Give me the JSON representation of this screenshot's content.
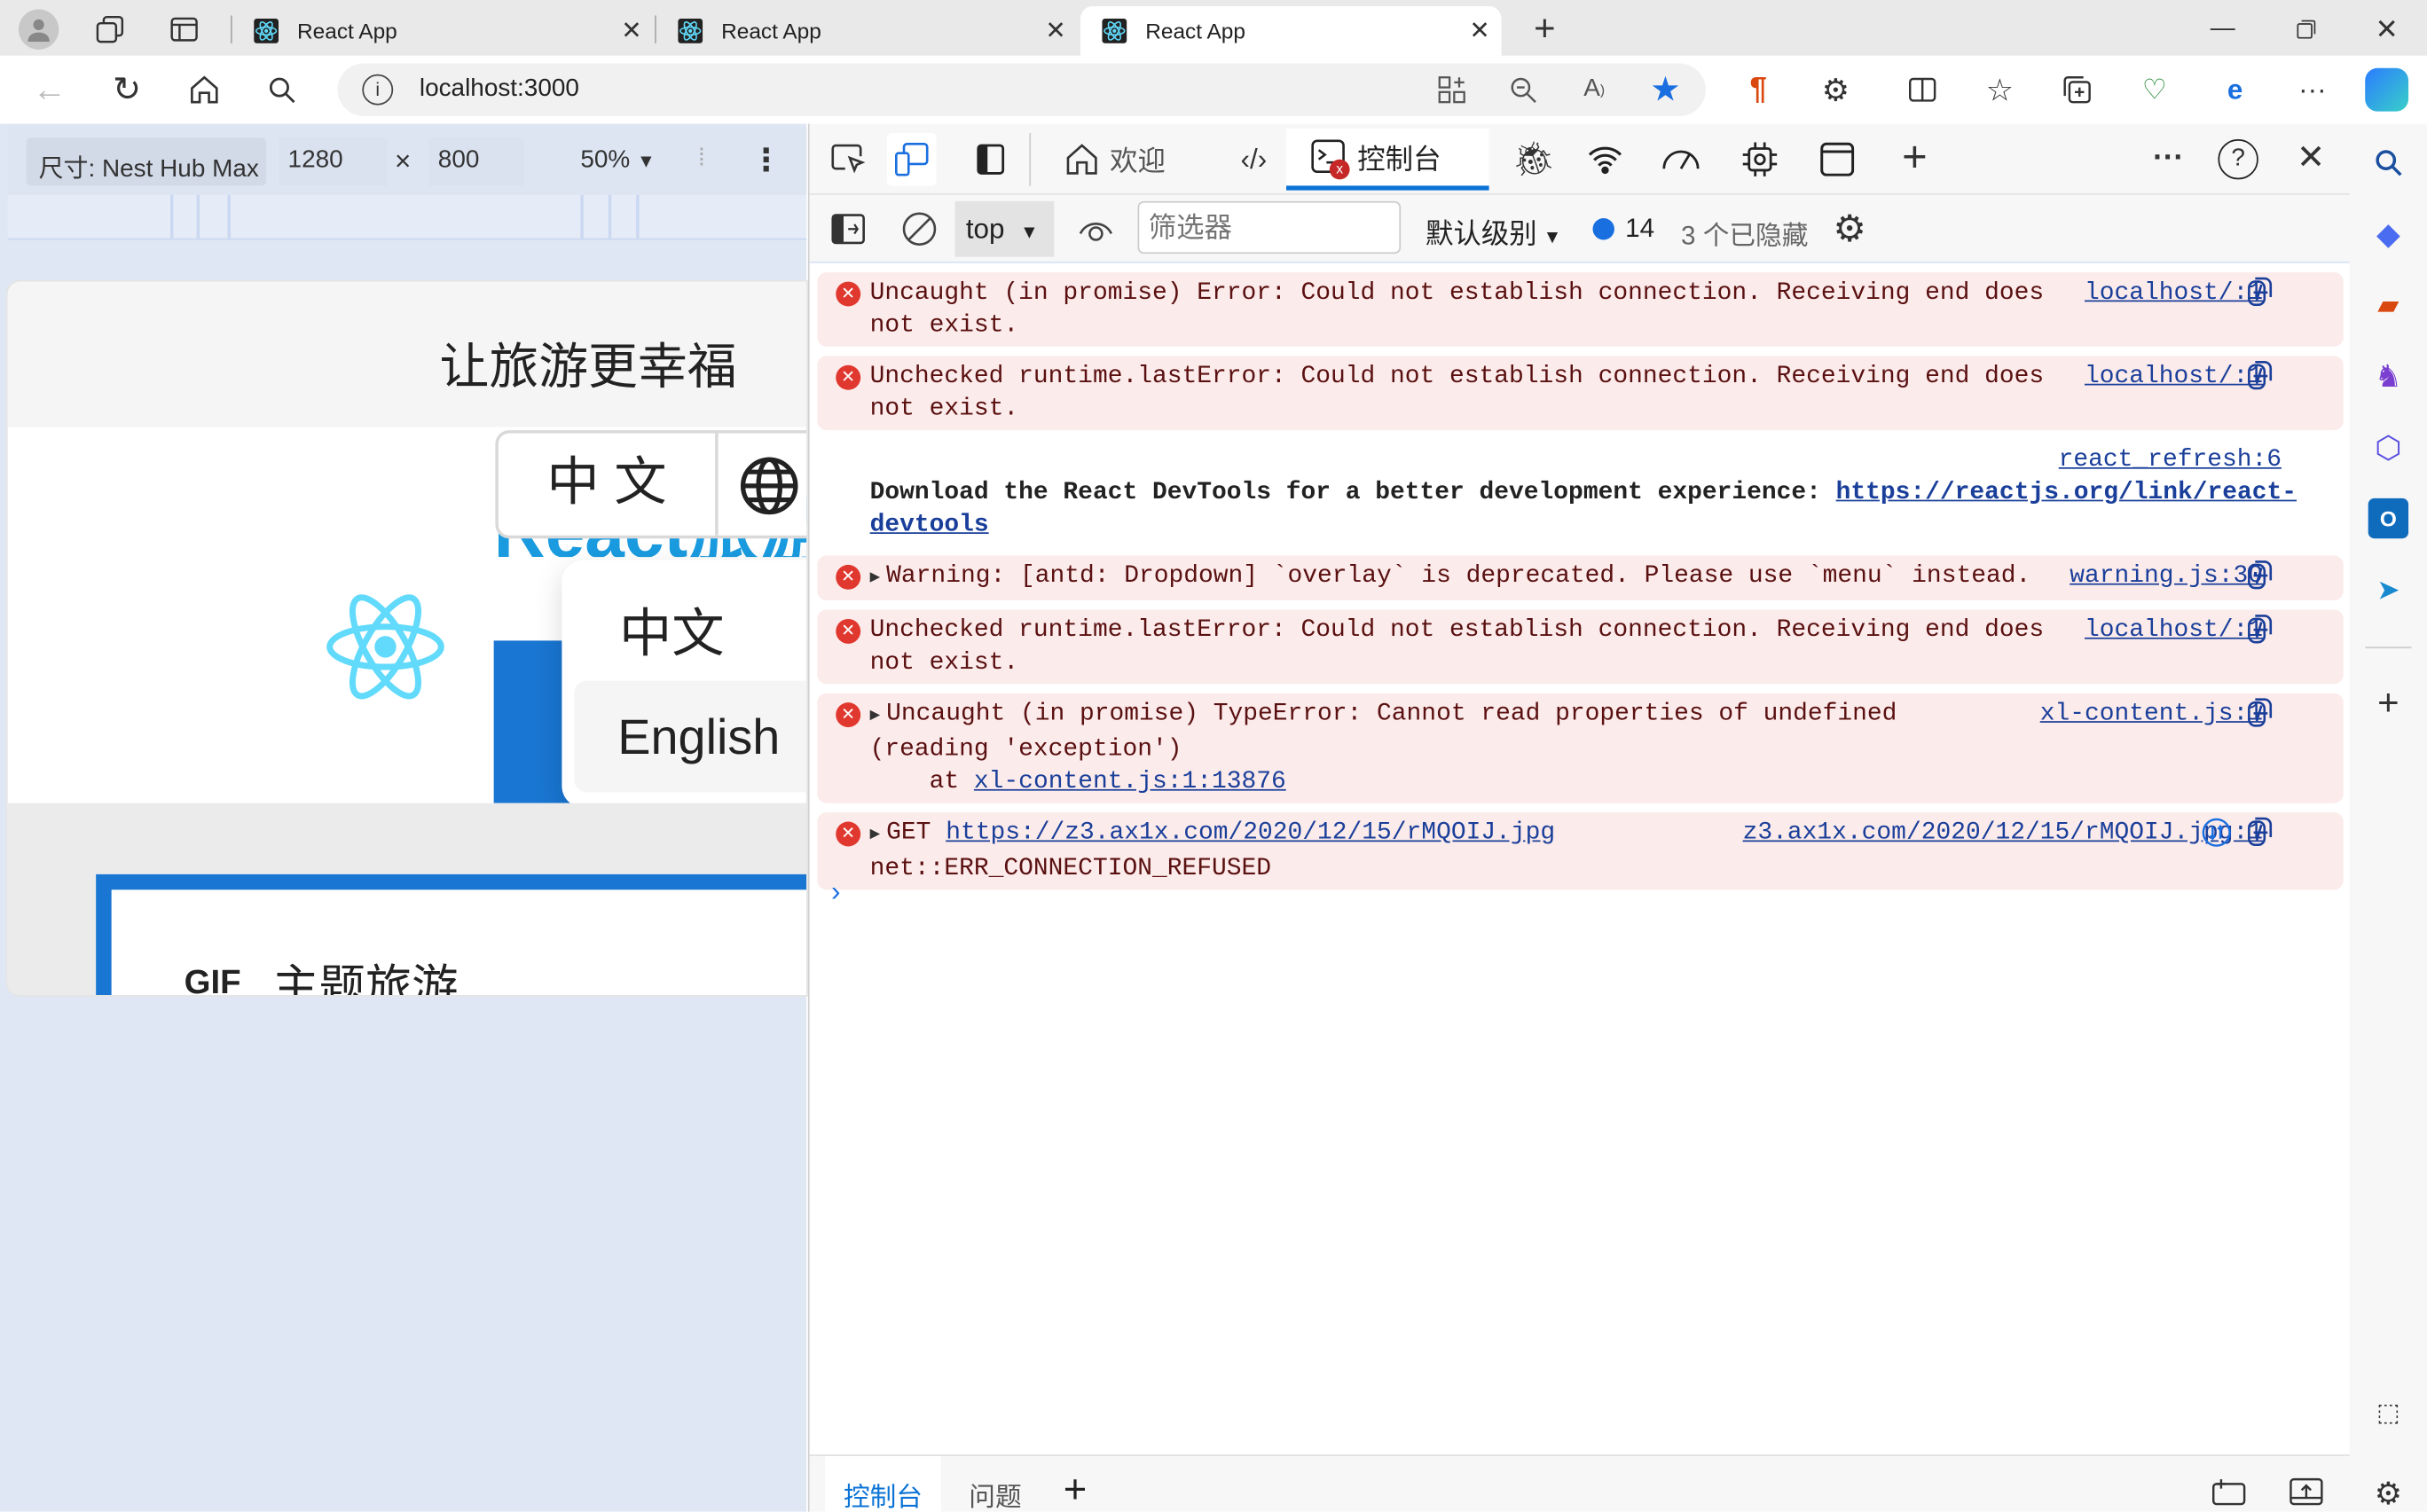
{
  "browser": {
    "tabs": [
      {
        "title": "React App",
        "active": false
      },
      {
        "title": "React App",
        "active": false
      },
      {
        "title": "React App",
        "active": true
      }
    ],
    "url": "localhost:3000"
  },
  "device_toolbar": {
    "device": "尺寸: Nest Hub Max",
    "width": "1280",
    "times": "×",
    "height": "800",
    "zoom": "50%"
  },
  "page": {
    "slogan": "让旅游更幸福",
    "brand": "React旅游网",
    "lang_button": "中 文",
    "lang_menu": [
      "中文",
      "English"
    ],
    "section_badge": "GIF",
    "section_title": "主题旅游",
    "accent": "#1976d2",
    "react_color": "#61dafb"
  },
  "devtools": {
    "tabs": {
      "welcome": "欢迎",
      "console": "控制台"
    },
    "console_bar": {
      "context": "top",
      "filter_placeholder": "筛选器",
      "level": "默认级别",
      "message_count": "14",
      "hidden": "3 个已隐藏"
    },
    "messages": [
      {
        "level": "error",
        "parts": [
          {
            "t": "Uncaught (in promise) Error: Could not establish connection. Receiving end does not exist."
          }
        ],
        "source": "localhost/:1"
      },
      {
        "level": "error",
        "parts": [
          {
            "t": "Unchecked runtime.lastError: Could not establish connection. Receiving end does not exist."
          }
        ],
        "source": "localhost/:1"
      },
      {
        "level": "info",
        "parts": [
          {
            "t": "Download the React DevTools for a better development experience: "
          },
          {
            "link": "https://reactjs.org/link/react-devtools"
          }
        ],
        "source": "react_refresh:6"
      },
      {
        "level": "error",
        "expandable": true,
        "parts": [
          {
            "t": "Warning: [antd: Dropdown] `overlay` is deprecated. Please use `menu` instead."
          }
        ],
        "source": "warning.js:30"
      },
      {
        "level": "error",
        "parts": [
          {
            "t": "Unchecked runtime.lastError: Could not establish connection. Receiving end does not exist."
          }
        ],
        "source": "localhost/:1"
      },
      {
        "level": "error",
        "expandable": true,
        "parts": [
          {
            "t": "Uncaught (in promise) TypeError: Cannot read properties of undefined\n(reading 'exception')\n    at "
          },
          {
            "link": "xl-content.js:1:13876"
          }
        ],
        "source": "xl-content.js:1"
      },
      {
        "level": "error",
        "expandable": true,
        "network": true,
        "parts": [
          {
            "t": "GET "
          },
          {
            "link": "https://z3.ax1x.com/2020/12/15/rMQOIJ.jpg"
          },
          {
            "t": "\nnet::ERR_CONNECTION_REFUSED"
          }
        ],
        "source": "z3.ax1x.com/2020/12/15/rMQOIJ.jpg:1"
      }
    ],
    "drawer_tabs": [
      "控制台",
      "问题"
    ]
  }
}
